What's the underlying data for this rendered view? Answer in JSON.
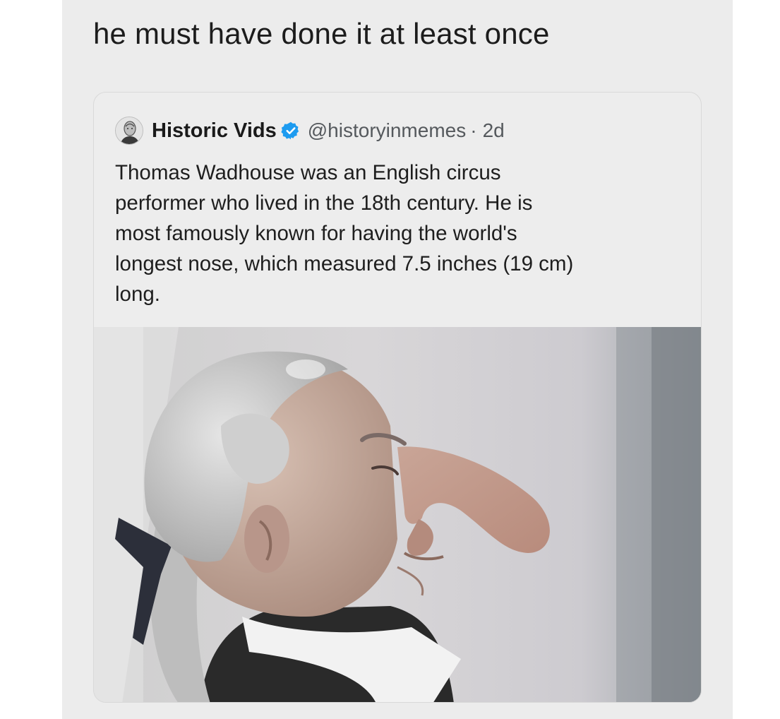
{
  "post": {
    "caption": "he must have done it at least once"
  },
  "quote_tweet": {
    "display_name": "Historic Vids",
    "handle": "@historyinmemes",
    "separator": "·",
    "age": "2d",
    "text": "Thomas Wadhouse was an English circus\nperformer who lived in the 18th century. He is\nmost famously known for having the world's\nlongest nose, which measured 7.5 inches (19 cm)\nlong.",
    "verified_color": "#1d9bf0",
    "avatar_icon": "portrait-avatar-icon",
    "verified_icon": "verified-badge-icon"
  },
  "media": {
    "subject": "wax-figure-photo"
  }
}
